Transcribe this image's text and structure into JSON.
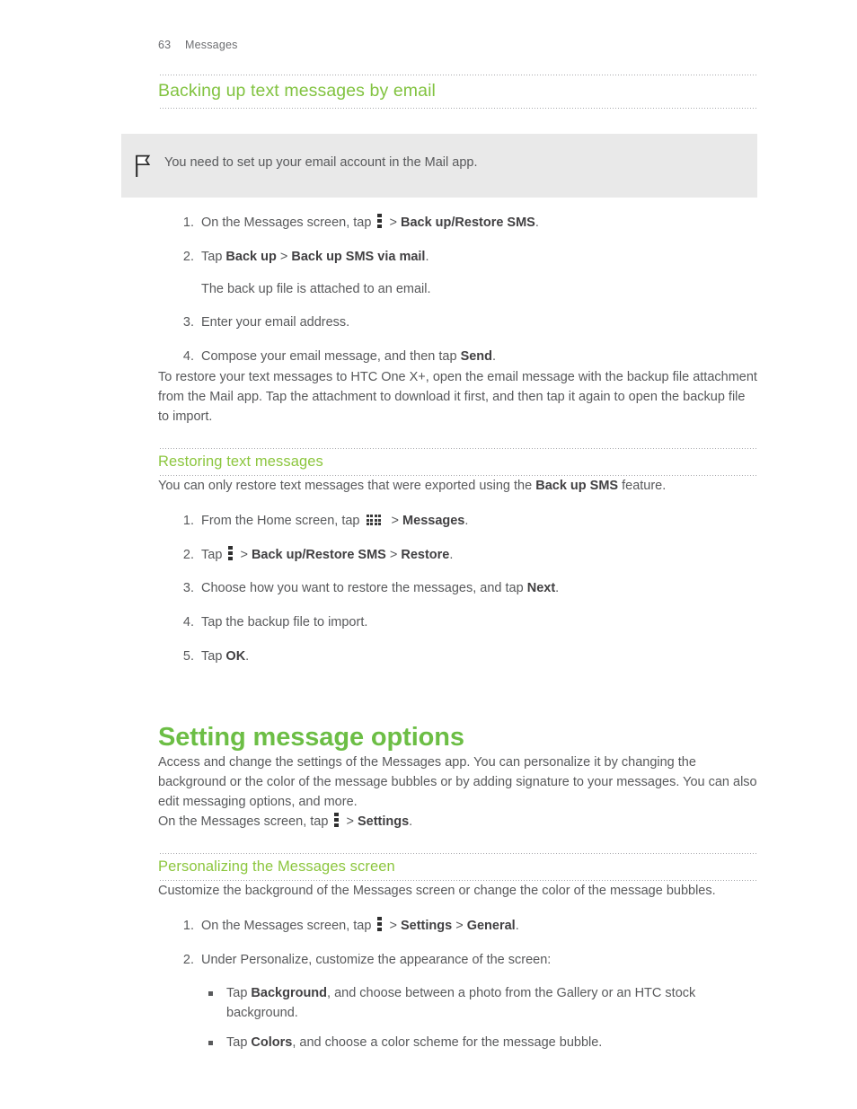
{
  "header": {
    "page_number": "63",
    "chapter": "Messages"
  },
  "icons": {
    "overflow_menu": "vertical-three-dot-menu-icon",
    "all_apps": "app-grid-icon",
    "note_flag": "flag-icon"
  },
  "sections": [
    {
      "id": "backing-up",
      "heading": "Backing up text messages by email",
      "note": "You need to set up your email account in the Mail app.",
      "steps": [
        {
          "num": "1.",
          "parts": [
            {
              "t": "text",
              "v": "On the Messages screen, tap "
            },
            {
              "t": "icon",
              "v": "overflow_menu"
            },
            {
              "t": "text",
              "v": " > "
            },
            {
              "t": "bold",
              "v": "Back up/Restore SMS"
            },
            {
              "t": "text",
              "v": "."
            }
          ]
        },
        {
          "num": "2.",
          "parts": [
            {
              "t": "text",
              "v": "Tap "
            },
            {
              "t": "bold",
              "v": "Back up"
            },
            {
              "t": "text",
              "v": " > "
            },
            {
              "t": "bold",
              "v": "Back up SMS via mail"
            },
            {
              "t": "text",
              "v": "."
            }
          ],
          "sub_note": "The back up file is attached to an email."
        },
        {
          "num": "3.",
          "parts": [
            {
              "t": "text",
              "v": "Enter your email address."
            }
          ]
        },
        {
          "num": "4.",
          "parts": [
            {
              "t": "text",
              "v": "Compose your email message, and then tap "
            },
            {
              "t": "bold",
              "v": "Send"
            },
            {
              "t": "text",
              "v": "."
            }
          ]
        }
      ],
      "closing_paragraph": "To restore your text messages to HTC One X+, open the email message with the backup file attachment from the Mail app. Tap the attachment to download it first, and then tap it again to open the backup file to import."
    },
    {
      "id": "restoring",
      "heading": "Restoring text messages",
      "intro_parts": [
        {
          "t": "text",
          "v": "You can only restore text messages that were exported using the "
        },
        {
          "t": "bold",
          "v": "Back up SMS"
        },
        {
          "t": "text",
          "v": " feature."
        }
      ],
      "steps": [
        {
          "num": "1.",
          "parts": [
            {
              "t": "text",
              "v": "From the Home screen, tap "
            },
            {
              "t": "icon",
              "v": "all_apps"
            },
            {
              "t": "text",
              "v": " > "
            },
            {
              "t": "bold",
              "v": "Messages"
            },
            {
              "t": "text",
              "v": "."
            }
          ]
        },
        {
          "num": "2.",
          "parts": [
            {
              "t": "text",
              "v": "Tap "
            },
            {
              "t": "icon",
              "v": "overflow_menu"
            },
            {
              "t": "text",
              "v": " > "
            },
            {
              "t": "bold",
              "v": "Back up/Restore SMS"
            },
            {
              "t": "text",
              "v": " > "
            },
            {
              "t": "bold",
              "v": "Restore"
            },
            {
              "t": "text",
              "v": "."
            }
          ]
        },
        {
          "num": "3.",
          "parts": [
            {
              "t": "text",
              "v": "Choose how you want to restore the messages, and tap "
            },
            {
              "t": "bold",
              "v": "Next"
            },
            {
              "t": "text",
              "v": "."
            }
          ]
        },
        {
          "num": "4.",
          "parts": [
            {
              "t": "text",
              "v": "Tap the backup file to import."
            }
          ]
        },
        {
          "num": "5.",
          "parts": [
            {
              "t": "text",
              "v": "Tap "
            },
            {
              "t": "bold",
              "v": "OK"
            },
            {
              "t": "text",
              "v": "."
            }
          ]
        }
      ]
    }
  ],
  "main_section": {
    "title": "Setting message options",
    "intro": "Access and change the settings of the Messages app. You can personalize it by changing the background or the color of the message bubbles or by adding signature to your messages. You can also edit messaging options, and more.",
    "path_line_parts": [
      {
        "t": "text",
        "v": "On the Messages screen, tap "
      },
      {
        "t": "icon",
        "v": "overflow_menu"
      },
      {
        "t": "text",
        "v": " > "
      },
      {
        "t": "bold",
        "v": "Settings"
      },
      {
        "t": "text",
        "v": "."
      }
    ],
    "subsection": {
      "heading": "Personalizing the Messages screen",
      "intro": "Customize the background of the Messages screen or change the color of the message bubbles.",
      "steps": [
        {
          "num": "1.",
          "parts": [
            {
              "t": "text",
              "v": "On the Messages screen, tap "
            },
            {
              "t": "icon",
              "v": "overflow_menu"
            },
            {
              "t": "text",
              "v": " > "
            },
            {
              "t": "bold",
              "v": "Settings"
            },
            {
              "t": "text",
              "v": " > "
            },
            {
              "t": "bold",
              "v": "General"
            },
            {
              "t": "text",
              "v": "."
            }
          ]
        },
        {
          "num": "2.",
          "parts": [
            {
              "t": "text",
              "v": "Under Personalize, customize the appearance of the screen:"
            }
          ],
          "bullets": [
            [
              {
                "t": "text",
                "v": "Tap "
              },
              {
                "t": "bold",
                "v": "Background"
              },
              {
                "t": "text",
                "v": ", and choose between a photo from the Gallery or an HTC stock background."
              }
            ],
            [
              {
                "t": "text",
                "v": "Tap "
              },
              {
                "t": "bold",
                "v": "Colors"
              },
              {
                "t": "text",
                "v": ", and choose a color scheme for the message bubble."
              }
            ]
          ]
        }
      ]
    }
  },
  "colors": {
    "heading_green_h1": "#6cbe45",
    "heading_green_h2": "#82c341",
    "heading_green_h3": "#8cc63e",
    "body_text": "#58595b",
    "note_background": "#e9e9e9",
    "rule_dot": "#a8a9ad"
  }
}
